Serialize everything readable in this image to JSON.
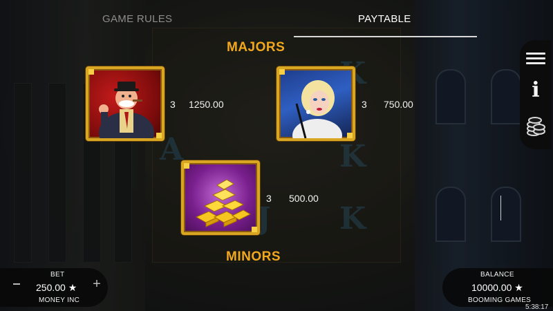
{
  "tabs": [
    {
      "label": "GAME RULES",
      "active": false
    },
    {
      "label": "PAYTABLE",
      "active": true
    }
  ],
  "sections": {
    "majors": "MAJORS",
    "minors": "MINORS"
  },
  "paytable": [
    {
      "symbol": "boss-symbol",
      "count": "3",
      "payout": "1250.00"
    },
    {
      "symbol": "lady-symbol",
      "count": "3",
      "payout": "750.00"
    },
    {
      "symbol": "gold-bars-symbol",
      "count": "3",
      "payout": "500.00"
    }
  ],
  "bet": {
    "label": "BET",
    "value": "250.00 ★",
    "game_name": "MONEY INC"
  },
  "balance": {
    "label": "BALANCE",
    "value": "10000.00 ★",
    "brand": "BOOMING GAMES"
  },
  "clock": "5:38:17",
  "side_menu": [
    "menu-icon",
    "info-icon",
    "coins-icon"
  ],
  "colors": {
    "accent": "#f2a81d",
    "tile_border": "#d9a623",
    "panel": "#080808"
  }
}
